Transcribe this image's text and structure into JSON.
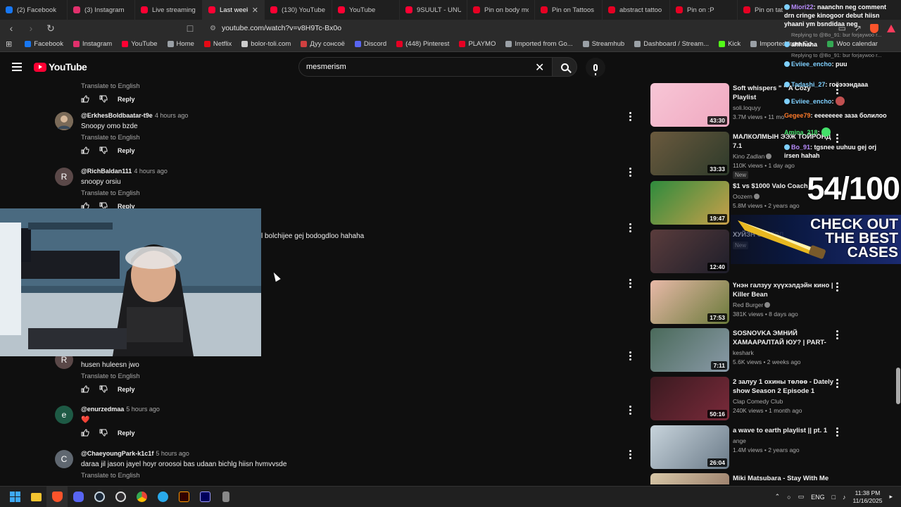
{
  "browser": {
    "tabs": [
      {
        "label": "(2) Facebook",
        "color": "#1877f2",
        "active": false
      },
      {
        "label": "(3) Instagram",
        "color": "#e1306c",
        "active": false
      },
      {
        "label": "Live streaming - Y",
        "color": "#ff0033",
        "active": false
      },
      {
        "label": "Last week -",
        "color": "#ff0033",
        "active": true
      },
      {
        "label": "(130) YouTube",
        "color": "#ff0033",
        "active": false
      },
      {
        "label": "YouTube",
        "color": "#ff0033",
        "active": false
      },
      {
        "label": "9SUULT - UNUU",
        "color": "#ff0033",
        "active": false
      },
      {
        "label": "Pin on body mod",
        "color": "#e60023",
        "active": false
      },
      {
        "label": "Pin on Tattoos",
        "color": "#e60023",
        "active": false
      },
      {
        "label": "abstract tattoo by",
        "color": "#e60023",
        "active": false
      },
      {
        "label": "Pin on :P",
        "color": "#e60023",
        "active": false
      },
      {
        "label": "Pin on tat",
        "color": "#e60023",
        "active": false
      }
    ],
    "url": "youtube.com/watch?v=v8H9Tc-Bx0o",
    "bookmarks": [
      {
        "label": "Facebook",
        "color": "#1877f2"
      },
      {
        "label": "Instagram",
        "color": "#e1306c"
      },
      {
        "label": "YouTube",
        "color": "#ff0033"
      },
      {
        "label": "Home",
        "color": "#9aa0a6"
      },
      {
        "label": "Netflix",
        "color": "#e50914"
      },
      {
        "label": "bolor-toli.com",
        "color": "#cccccc"
      },
      {
        "label": "Дуу сонсоё",
        "color": "#d04040"
      },
      {
        "label": "Discord",
        "color": "#5865f2"
      },
      {
        "label": "(448) Pinterest",
        "color": "#e60023"
      },
      {
        "label": "PLAYMO",
        "color": "#e60023"
      },
      {
        "label": "Imported from Go...",
        "color": "#9aa0a6"
      },
      {
        "label": "Streamhub",
        "color": "#9aa0a6"
      },
      {
        "label": "Dashboard / Stream...",
        "color": "#9aa0a6"
      },
      {
        "label": "Kick",
        "color": "#53fc18"
      },
      {
        "label": "Imported from Go...",
        "color": "#9aa0a6"
      },
      {
        "label": "Woo calendar",
        "color": "#34a853"
      }
    ]
  },
  "youtube": {
    "logo_text": "YouTube",
    "search_value": "mesmerism"
  },
  "comments": {
    "translate_label": "Translate to English",
    "reply_label": "Reply",
    "items": [
      {
        "author": "@ErkhesBoldbaatar-t9e",
        "time": "4 hours ago",
        "text": "Snoopy omo bzde",
        "avatar_letter": "",
        "avatar_color": "#7a6a58",
        "translate": true
      },
      {
        "author": "@RichBaldan111",
        "time": "4 hours ago",
        "text": "snoopy orsiu",
        "avatar_letter": "R",
        "avatar_color": "#5a4848",
        "translate": true
      },
      {
        "author": "",
        "time": "",
        "text": "l bolchijee gej bodogdloo hahaha",
        "avatar_letter": "",
        "avatar_color": "",
        "translate": false
      },
      {
        "author": "",
        "time": "",
        "text": "husen huleesn jwo",
        "avatar_letter": "R",
        "avatar_color": "#5a4848",
        "translate": true
      },
      {
        "author": "@enurzedmaa",
        "time": "5 hours ago",
        "text": "❤️",
        "avatar_letter": "e",
        "avatar_color": "#1e5a45",
        "translate": false
      },
      {
        "author": "@ChaeyoungPark-k1c1f",
        "time": "5 hours ago",
        "text": "daraa jil jason jayel hoyr oroosoi bas udaan bichlg hiisn hvmvvsde",
        "avatar_letter": "C",
        "avatar_color": "#5f6770",
        "translate": true
      }
    ]
  },
  "related": [
    {
      "title": "Soft whispers \" \" A Cozy Playlist",
      "channel": "soli.loquyy",
      "stats": "3.7M views • 11 mo",
      "duration": "43:30",
      "new": false,
      "verified": false,
      "thumb": "linear-gradient(135deg,#f7c6d6,#f0a8c0)"
    },
    {
      "title": "МАЛКОЛМЫН ЭЭЖ ТОЙРОНД 7.1",
      "channel": "Kino Zadlan",
      "stats": "110K views • 1 day ago",
      "duration": "33:33",
      "new": true,
      "verified": true,
      "thumb": "linear-gradient(135deg,#6b5a3e,#2d3a2a)"
    },
    {
      "title": "$1 vs $1000 Valo Coach",
      "channel": "Oozern",
      "stats": "5.8M views • 2 years ago",
      "duration": "19:47",
      "new": false,
      "verified": true,
      "thumb": "linear-gradient(135deg,#2e8b3d,#c9a04a)"
    },
    {
      "title": "ХУЙЗН СЭТГЭЛ",
      "channel": "",
      "stats": "",
      "duration": "12:40",
      "new": true,
      "verified": false,
      "thumb": "linear-gradient(135deg,#5a3c3c,#1e1e2a)"
    },
    {
      "title": "Үнэн галзуу хүүхэлдэйн кино | Killer Bean",
      "channel": "Red Burger",
      "stats": "381K views • 8 days ago",
      "duration": "17:53",
      "new": false,
      "verified": true,
      "thumb": "linear-gradient(135deg,#e8b9a8,#6a7a3a)"
    },
    {
      "title": "SOSNOVKA ЭМНИЙ ХАМААРАЛТАЙ ЮУ? | PART-2...",
      "channel": "keshark",
      "stats": "5.6K views • 2 weeks ago",
      "duration": "7:11",
      "new": false,
      "verified": false,
      "thumb": "linear-gradient(135deg,#4a6a5a,#8a9aa8)"
    },
    {
      "title": "2 залуу 1 охины төлөө - Dately show Season 2 Episode 1",
      "channel": "Clap Comedy Club",
      "stats": "240K views • 1 month ago",
      "duration": "50:16",
      "new": false,
      "verified": false,
      "thumb": "linear-gradient(135deg,#3a1a20,#7a2a3a)"
    },
    {
      "title": "a wave to earth playlist || pt. 1",
      "channel": "ange",
      "stats": "1.4M views • 2 years ago",
      "duration": "26:04",
      "new": false,
      "verified": false,
      "thumb": "linear-gradient(135deg,#c8d4dc,#6a7a88)"
    },
    {
      "title": "Miki Matsubara - Stay With Me",
      "channel": "",
      "stats": "",
      "duration": "",
      "new": false,
      "verified": false,
      "thumb": "linear-gradient(135deg,#d8c8a8,#8a6a5a)"
    }
  ],
  "stream_chat": {
    "lines": [
      {
        "user": "Miori22",
        "user_color": "#b98cff",
        "message": "naanchn neg comment",
        "badge": true
      },
      {
        "user": "",
        "user_color": "#ffffff",
        "message": "drn cringe kinogoor debut hiisn",
        "badge": false
      },
      {
        "user": "",
        "user_color": "#ffffff",
        "message": "yhaani ym bsndidaa neg",
        "badge": false
      },
      {
        "user": "",
        "user_color": "#ff6b6b",
        "message": "ahhhaha",
        "badge": true
      },
      {
        "user": "Eviiee_encho",
        "user_color": "#7fd0ff",
        "message": "puu",
        "badge": true
      },
      {
        "user": "Tadashi_27",
        "user_color": "#7fd0ff",
        "message": "гоёэээндааа",
        "badge": true
      },
      {
        "user": "Eviiee_encho",
        "user_color": "#7fd0ff",
        "message": "",
        "badge": true
      },
      {
        "user": "Gegee79",
        "user_color": "#ff7a2a",
        "message": "ееееееее заза болилоо",
        "badge": false
      },
      {
        "user": "Amina_218",
        "user_color": "#44e06a",
        "message": "",
        "badge": false
      },
      {
        "user": "Bo_91",
        "user_color": "#b98cff",
        "message": "tgsnee uuhuu gej orj",
        "badge": true
      },
      {
        "user": "",
        "user_color": "#ffffff",
        "message": "irsen hahah",
        "badge": false
      }
    ],
    "replies": [
      "Replying to @Bo_91: bur forjaywoo r...",
      "Replying to @Bo_91: bur forjaywoo r..."
    ]
  },
  "stream_overlay": {
    "counter": "54/100",
    "promo_line1": "CHECK OUT",
    "promo_line2": "THE BEST",
    "promo_line3": "CASES"
  },
  "taskbar": {
    "language": "ENG",
    "time": "11:38 PM",
    "date": "11/16/2025"
  }
}
